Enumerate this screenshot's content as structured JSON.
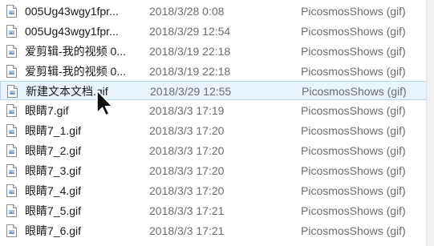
{
  "files": [
    {
      "name": "005Ug43wgy1fpr...",
      "date": "2018/3/28 0:08",
      "type": "PicosmosShows (gif)"
    },
    {
      "name": "005Ug43wgy1fpr...",
      "date": "2018/3/29 12:54",
      "type": "PicosmosShows (gif)"
    },
    {
      "name": "爱剪辑-我的视频 0...",
      "date": "2018/3/19 22:18",
      "type": "PicosmosShows (gif)"
    },
    {
      "name": "爱剪辑-我的视频 0...",
      "date": "2018/3/19 22:18",
      "type": "PicosmosShows (gif)"
    },
    {
      "name": "新建文本文档.gif",
      "date": "2018/3/29 12:55",
      "type": "PicosmosShows (gif)"
    },
    {
      "name": "眼睛7.gif",
      "date": "2018/3/3 17:19",
      "type": "PicosmosShows (gif)"
    },
    {
      "name": "眼睛7_1.gif",
      "date": "2018/3/3 17:20",
      "type": "PicosmosShows (gif)"
    },
    {
      "name": "眼睛7_2.gif",
      "date": "2018/3/3 17:20",
      "type": "PicosmosShows (gif)"
    },
    {
      "name": "眼睛7_3.gif",
      "date": "2018/3/3 17:20",
      "type": "PicosmosShows (gif)"
    },
    {
      "name": "眼睛7_4.gif",
      "date": "2018/3/3 17:20",
      "type": "PicosmosShows (gif)"
    },
    {
      "name": "眼睛7_5.gif",
      "date": "2018/3/3 17:21",
      "type": "PicosmosShows (gif)"
    },
    {
      "name": "眼睛7_6.gif",
      "date": "2018/3/3 17:21",
      "type": "PicosmosShows (gif)"
    }
  ],
  "selected_index": 4,
  "file_icon": "document-icon",
  "cursor_icon": "mouse-pointer-icon",
  "colors": {
    "selection_background": "#e9f3fd",
    "selection_border": "#b7d6f6",
    "name_text": "#1a1a1a",
    "detail_text": "#6d6d6d"
  }
}
